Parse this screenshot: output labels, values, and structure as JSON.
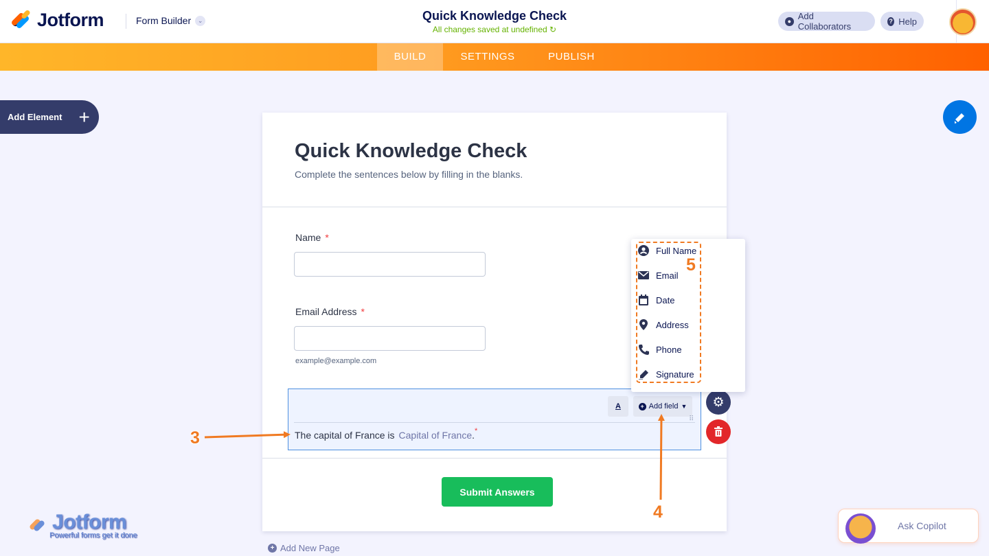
{
  "header": {
    "brand": "Jotform",
    "builder_label": "Form Builder",
    "form_title": "Quick Knowledge Check",
    "save_status": "All changes saved at undefined ↻",
    "collaborators_label": "Add Collaborators",
    "help_label": "Help"
  },
  "nav": {
    "tabs": [
      {
        "label": "BUILD",
        "active": true
      },
      {
        "label": "SETTINGS"
      },
      {
        "label": "PUBLISH"
      }
    ]
  },
  "sidebar": {
    "add_element_label": "Add Element"
  },
  "form": {
    "title": "Quick Knowledge Check",
    "subtitle": "Complete the sentences below by filling in the blanks.",
    "fields": {
      "name_label": "Name",
      "email_label": "Email Address",
      "email_sublabel": "example@example.com",
      "required_mark": "*"
    },
    "fill_in": {
      "sentence": "The capital of France is",
      "blank_placeholder": "Capital of France",
      "tail": ".",
      "format_label": "A",
      "add_field_label": "Add field"
    },
    "submit_label": "Submit Answers"
  },
  "dropdown": {
    "items": [
      "Full Name",
      "Email",
      "Date",
      "Address",
      "Phone",
      "Signature"
    ]
  },
  "annotations": {
    "a3": "3",
    "a4": "4",
    "a5": "5"
  },
  "footer": {
    "add_page_label": "Add New Page",
    "watermark_brand": "Jotform",
    "watermark_tagline": "Powerful forms get it done",
    "copilot_label": "Ask Copilot"
  },
  "colors": {
    "orange_start": "#ffb629",
    "orange_end": "#ff6100",
    "navy": "#0a1551",
    "submit_green": "#18bd5b",
    "annotation": "#f07a22"
  }
}
